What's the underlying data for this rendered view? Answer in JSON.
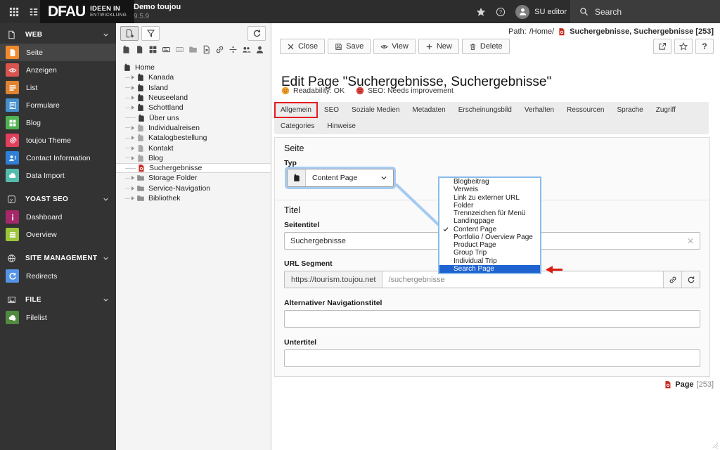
{
  "topbar": {
    "logo_main": "DFAU",
    "logo_sub1": "IDEEN IN",
    "logo_sub2": "ENTWICKLUNG",
    "site_name": "Demo toujou",
    "version": "9.5.9",
    "user": "SU editor",
    "search": "Search"
  },
  "sidebar": {
    "sections": [
      {
        "label": "WEB",
        "icon": "doc-outline",
        "items": [
          {
            "label": "Seite",
            "icon": "page-white",
            "color": "#ef8b2e",
            "active": true
          },
          {
            "label": "Anzeigen",
            "icon": "eye",
            "color": "#d9534f"
          },
          {
            "label": "List",
            "icon": "list",
            "color": "#e08331"
          },
          {
            "label": "Formulare",
            "icon": "form",
            "color": "#4590cf"
          },
          {
            "label": "Blog",
            "icon": "grid",
            "color": "#50b251"
          },
          {
            "label": "toujou Theme",
            "icon": "fingerprint",
            "color": "#e23f5c"
          },
          {
            "label": "Contact Information",
            "icon": "contact",
            "color": "#2f7fd6"
          },
          {
            "label": "Data Import",
            "icon": "cloud",
            "color": "#53bcae"
          }
        ]
      },
      {
        "label": "YOAST SEO",
        "icon": "yoast",
        "items": [
          {
            "label": "Dashboard",
            "icon": "info",
            "color": "#a4286a"
          },
          {
            "label": "Overview",
            "icon": "bars",
            "color": "#9bc53a"
          }
        ]
      },
      {
        "label": "SITE MANAGEMENT",
        "icon": "globe",
        "items": [
          {
            "label": "Redirects",
            "icon": "redo",
            "color": "#5493e6"
          }
        ]
      },
      {
        "label": "FILE",
        "icon": "image",
        "items": [
          {
            "label": "Filelist",
            "icon": "cloudfile",
            "color": "#4f8a3f"
          }
        ]
      }
    ]
  },
  "pagetree": {
    "drag_icons": [
      "page",
      "doc",
      "grid",
      "card",
      "card-num",
      "folder",
      "page-arrow",
      "link",
      "divider",
      "people",
      "person"
    ],
    "nodes": [
      {
        "label": "Home",
        "depth": 0,
        "icon": "page",
        "tone": "dark"
      },
      {
        "label": "Kanada",
        "depth": 1,
        "exp": true,
        "icon": "page",
        "tone": "dark"
      },
      {
        "label": "Island",
        "depth": 1,
        "exp": true,
        "icon": "page",
        "tone": "dark"
      },
      {
        "label": "Neuseeland",
        "depth": 1,
        "exp": true,
        "icon": "page",
        "tone": "dark"
      },
      {
        "label": "Schottland",
        "depth": 1,
        "exp": true,
        "icon": "page",
        "tone": "dark"
      },
      {
        "label": "Über uns",
        "depth": 1,
        "icon": "page",
        "tone": "dark"
      },
      {
        "label": "Individualreisen",
        "depth": 1,
        "exp": true,
        "icon": "page",
        "tone": "light"
      },
      {
        "label": "Katalogbestellung",
        "depth": 1,
        "exp": true,
        "icon": "page",
        "tone": "light"
      },
      {
        "label": "Kontakt",
        "depth": 1,
        "exp": true,
        "icon": "doc",
        "tone": "light"
      },
      {
        "label": "Blog",
        "depth": 1,
        "exp": true,
        "icon": "page",
        "tone": "light"
      },
      {
        "label": "Suchergebnisse",
        "depth": 1,
        "icon": "page-search",
        "tone": "red",
        "selected": true
      },
      {
        "label": "Storage Folder",
        "depth": 1,
        "exp": true,
        "icon": "folder",
        "tone": "gray"
      },
      {
        "label": "Service-Navigation",
        "depth": 1,
        "exp": true,
        "icon": "folder",
        "tone": "gray"
      },
      {
        "label": "Bibliothek",
        "depth": 1,
        "exp": true,
        "icon": "folder",
        "tone": "gray"
      }
    ]
  },
  "docheader": {
    "path_label": "Path:",
    "path_value": "/Home/",
    "page_ref": "Suchergebnisse, Suchergebnisse [253]",
    "buttons": [
      {
        "label": "Close",
        "icon": "close"
      },
      {
        "label": "Save",
        "icon": "save"
      },
      {
        "label": "View",
        "icon": "eye-dark"
      },
      {
        "label": "New",
        "icon": "plus"
      },
      {
        "label": "Delete",
        "icon": "trash"
      }
    ]
  },
  "main": {
    "title": "Edit Page \"Suchergebnisse, Suchergebnisse\"",
    "readability_label": "Readability: OK",
    "seo_label": "SEO: Needs improvement",
    "tabs_row1": [
      "Allgemein",
      "SEO",
      "Soziale Medien",
      "Metadaten",
      "Erscheinungsbild",
      "Verhalten",
      "Ressourcen",
      "Sprache",
      "Zugriff"
    ],
    "tabs_row2": [
      "Categories",
      "Hinweise"
    ],
    "annotated_tab": "Allgemein",
    "form": {
      "section_title": "Seite",
      "type_label": "Typ",
      "type_value": "Content Page",
      "titel_heading": "Titel",
      "seitentitel_label": "Seitentitel",
      "seitentitel_value": "Suchergebnisse",
      "url_label": "URL Segment",
      "url_prefix": "https://tourism.toujou.net",
      "url_value": "/suchergebnisse",
      "nav_label": "Alternativer Navigationstitel",
      "nav_value": "",
      "untertitel_label": "Untertitel",
      "untertitel_value": ""
    },
    "footer_label": "Page",
    "footer_id": "[253]"
  },
  "dropdown": {
    "options": [
      "Blogbeitrag",
      "Verweis",
      "Link zu externer URL",
      "Folder",
      "Trennzeichen für Menü",
      "Landingpage",
      "Content Page",
      "Portfolio / Overview Page",
      "Product Page",
      "Group Trip",
      "Individual Trip",
      "Search Page"
    ],
    "checked": "Content Page",
    "highlighted": "Search Page"
  },
  "colors": {
    "annotation_red": "#e51c23",
    "annotation_blue": "#a5cbf1",
    "highlight_row": "#1e63d0",
    "topbar_bg": "#2d2d2d",
    "sidebar_bg": "#333333"
  }
}
